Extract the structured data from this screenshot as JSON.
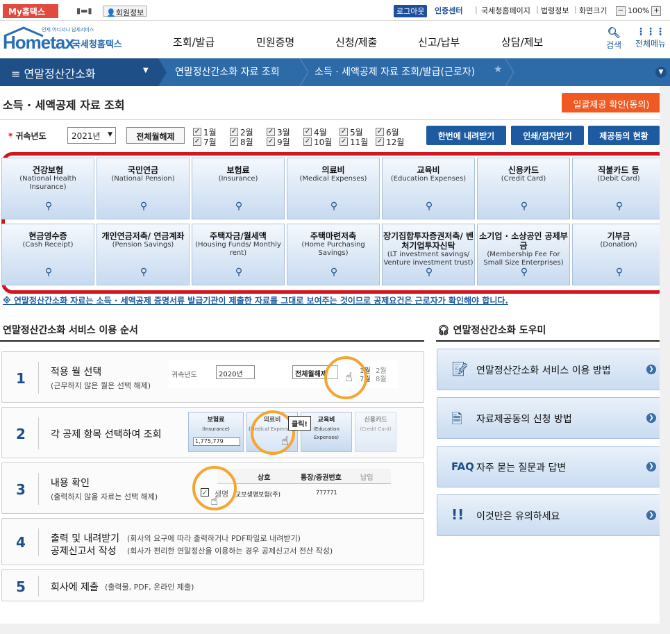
{
  "topbar": {
    "my_hometax": "My홈택스",
    "member_info": "회원정보",
    "logout": "로그아웃",
    "cert_center": "인증센터",
    "links": [
      "국세청홈페이지",
      "법령정보",
      "화면크기"
    ],
    "zoom": "100%"
  },
  "logo": {
    "tagline": "언제 어디서나 납세서비스",
    "brand": "Hometax",
    "brand_ko": "국세청홈택스"
  },
  "gnb": {
    "items": [
      "조회/발급",
      "민원증명",
      "신청/제출",
      "신고/납부",
      "상담/제보"
    ],
    "search": "검색",
    "allmenu": "전체메뉴"
  },
  "nav": {
    "menu": "연말정산간소화",
    "crumb1": "연말정산간소화 자료 조회",
    "crumb2": "소득 · 세액공제 자료 조회/발급(근로자)"
  },
  "page": {
    "title": "소득 · 세액공제 자료 조회",
    "consent_button": "일괄제공 확인(동의)"
  },
  "filter": {
    "year_label": "귀속년도",
    "year_value": "2021년",
    "clear_all": "전체월해제",
    "months": [
      "1월",
      "2월",
      "3월",
      "4월",
      "5월",
      "6월",
      "7월",
      "8월",
      "9월",
      "10월",
      "11월",
      "12월"
    ],
    "btn_download": "한번에 내려받기",
    "btn_print": "인쇄/점자받기",
    "btn_consent_status": "제공동의 현황"
  },
  "categories": [
    {
      "ko": "건강보험",
      "en": "(National Health Insurance)"
    },
    {
      "ko": "국민연금",
      "en": "(National Pension)"
    },
    {
      "ko": "보험료",
      "en": "(Insurance)"
    },
    {
      "ko": "의료비",
      "en": "(Medical Expenses)"
    },
    {
      "ko": "교육비",
      "en": "(Education Expenses)"
    },
    {
      "ko": "신용카드",
      "en": "(Credit Card)"
    },
    {
      "ko": "직불카드 등",
      "en": "(Debit Card)"
    },
    {
      "ko": "현금영수증",
      "en": "(Cash Receipt)"
    },
    {
      "ko": "개인연금저축/ 연금계좌",
      "en": "(Pension Savings)"
    },
    {
      "ko": "주택자금/월세액",
      "en": "(Housing Funds/ Monthly rent)"
    },
    {
      "ko": "주택마련저축",
      "en": "(Home Purchasing Savings)"
    },
    {
      "ko": "장기집합투자증권저축/ 벤처기업투자신탁",
      "en": "(LT investment savings/ Venture investment trust)"
    },
    {
      "ko": "소기업 · 소상공인 공제부금",
      "en": "(Membership Fee For Small Size Enterprises)"
    },
    {
      "ko": "기부금",
      "en": "(Donation)"
    }
  ],
  "notice": "※ 연말정산간소화 자료는 소득 · 세액공제 증명서류 발급기관이 제출한 자료를 그대로 보여주는 것이므로 공제요건은 근로자가 확인해야 합니다.",
  "service": {
    "title": "연말정산간소화 서비스 이용 순서",
    "steps": [
      {
        "num": "1",
        "main": "적용 월 선택",
        "sub": "(근무하지 않은 월은 선택 해제)"
      },
      {
        "num": "2",
        "main": "각 공제 항목 선택하여 조회",
        "sub": ""
      },
      {
        "num": "3",
        "main": "내용 확인",
        "sub": "(출력하지 않을 자료는 선택 해제)"
      },
      {
        "num": "4",
        "main": "출력 및 내려받기",
        "main2": "공제신고서 작성",
        "sub": "(회사의 요구에 따라 출력하거나 PDF파일로 내려받기)",
        "sub2": "(회사가 편리한 연말정산을 이용하는 경우 공제신고서 전산 작성)"
      },
      {
        "num": "5",
        "main": "회사에 제출",
        "sub": "(출력물, PDF, 온라인 제출)"
      }
    ],
    "thumb1": {
      "year_label": "귀속년도",
      "year_value": "2020년",
      "clear": "전체월해제",
      "m1": "1월",
      "m2": "2월",
      "m7": "7월",
      "m8": "8월"
    },
    "thumb2": {
      "c1": "보험료",
      "c1en": "(Insurance)",
      "c1val": "1,775,779",
      "c2": "의료비",
      "c2en": "(Medical Expenses)",
      "c3": "교육비",
      "c3en": "(Education Expenses)",
      "c4": "신용카드",
      "c4en": "(Credit Card)",
      "click": "클릭!"
    },
    "thumb3": {
      "h1": "상호",
      "h2": "통장/증권번호",
      "h3": "납입",
      "name": "생명",
      "company": "교보생명보험(주)",
      "acct": "777771"
    }
  },
  "helper": {
    "title": "연말정산간소화 도우미",
    "items": [
      "연말정산간소화 서비스 이용 방법",
      "자료제공동의 신청 방법",
      "자주 묻는 질문과 답변",
      "이것만은 유의하세요"
    ],
    "faq": "FAQ"
  }
}
